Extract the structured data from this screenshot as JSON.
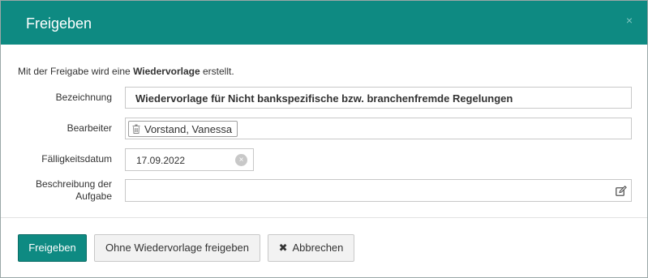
{
  "dialog": {
    "title": "Freigeben",
    "close_label": "×"
  },
  "info": {
    "prefix": "Mit der Freigabe wird eine ",
    "bold": "Wiedervorlage",
    "suffix": " erstellt."
  },
  "form": {
    "bezeichnung": {
      "label": "Bezeichnung",
      "value": "Wiedervorlage für Nicht bankspezifische bzw. branchenfremde Regelungen"
    },
    "bearbeiter": {
      "label": "Bearbeiter",
      "tag": "Vorstand, Vanessa"
    },
    "faelligkeit": {
      "label": "Fälligkeitsdatum",
      "value": "17.09.2022",
      "clear_label": "×"
    },
    "beschreibung": {
      "label_line1": "Beschreibung der",
      "label_line2": "Aufgabe",
      "value": ""
    }
  },
  "buttons": {
    "freigeben": "Freigeben",
    "ohne": "Ohne Wiedervorlage freigeben",
    "abbrechen_icon": "✖",
    "abbrechen": "Abbrechen"
  },
  "colors": {
    "accent": "#0e8a82"
  },
  "icons": {
    "close": "close-icon",
    "tag_remove": "trash-icon",
    "date_clear": "clear-icon",
    "edit": "edit-icon",
    "cancel": "x-icon"
  }
}
